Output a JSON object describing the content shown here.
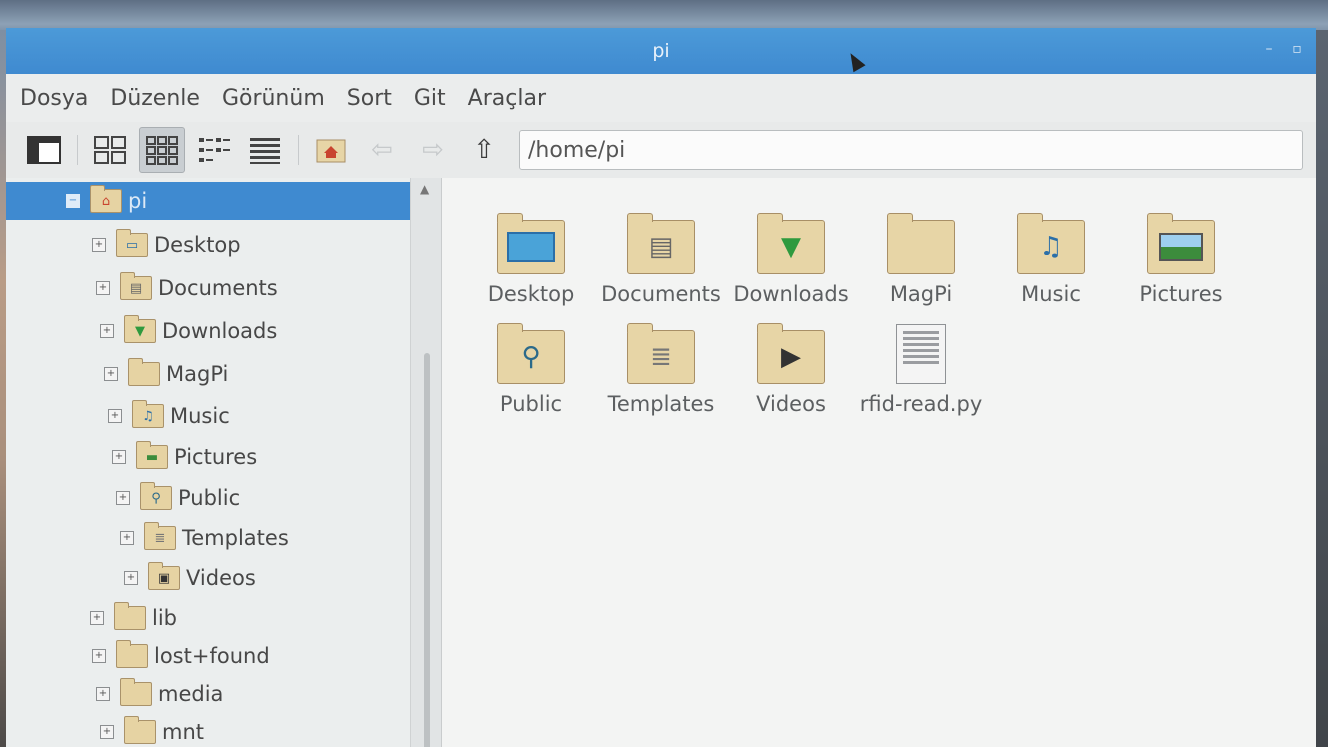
{
  "window": {
    "title": "pi"
  },
  "menu": [
    "Dosya",
    "Düzenle",
    "Görünüm",
    "Sort",
    "Git",
    "Araçlar"
  ],
  "address": {
    "path": "/home/pi"
  },
  "tree": [
    {
      "label": "pi",
      "icon": "home-icon",
      "selected": true
    },
    {
      "label": "Desktop",
      "icon": "desktop-icon"
    },
    {
      "label": "Documents",
      "icon": "documents-icon"
    },
    {
      "label": "Downloads",
      "icon": "download-icon"
    },
    {
      "label": "MagPi",
      "icon": "folder-icon"
    },
    {
      "label": "Music",
      "icon": "music-icon"
    },
    {
      "label": "Pictures",
      "icon": "pictures-icon"
    },
    {
      "label": "Public",
      "icon": "public-icon"
    },
    {
      "label": "Templates",
      "icon": "templates-icon"
    },
    {
      "label": "Videos",
      "icon": "videos-icon"
    },
    {
      "label": "lib",
      "icon": "folder-icon"
    },
    {
      "label": "lost+found",
      "icon": "folder-icon"
    },
    {
      "label": "media",
      "icon": "folder-icon"
    },
    {
      "label": "mnt",
      "icon": "folder-icon"
    }
  ],
  "files": [
    {
      "name": "Desktop",
      "icon": "desktop-folder-icon"
    },
    {
      "name": "Documents",
      "icon": "documents-folder-icon"
    },
    {
      "name": "Downloads",
      "icon": "downloads-folder-icon"
    },
    {
      "name": "MagPi",
      "icon": "folder-icon"
    },
    {
      "name": "Music",
      "icon": "music-folder-icon"
    },
    {
      "name": "Pictures",
      "icon": "pictures-folder-icon"
    },
    {
      "name": "Public",
      "icon": "public-folder-icon"
    },
    {
      "name": "Templates",
      "icon": "templates-folder-icon"
    },
    {
      "name": "Videos",
      "icon": "videos-folder-icon"
    },
    {
      "name": "rfid-read.py",
      "icon": "text-file-icon"
    }
  ],
  "colors": {
    "accent": "#3f8ad0",
    "folder": "#e7d5a6"
  }
}
